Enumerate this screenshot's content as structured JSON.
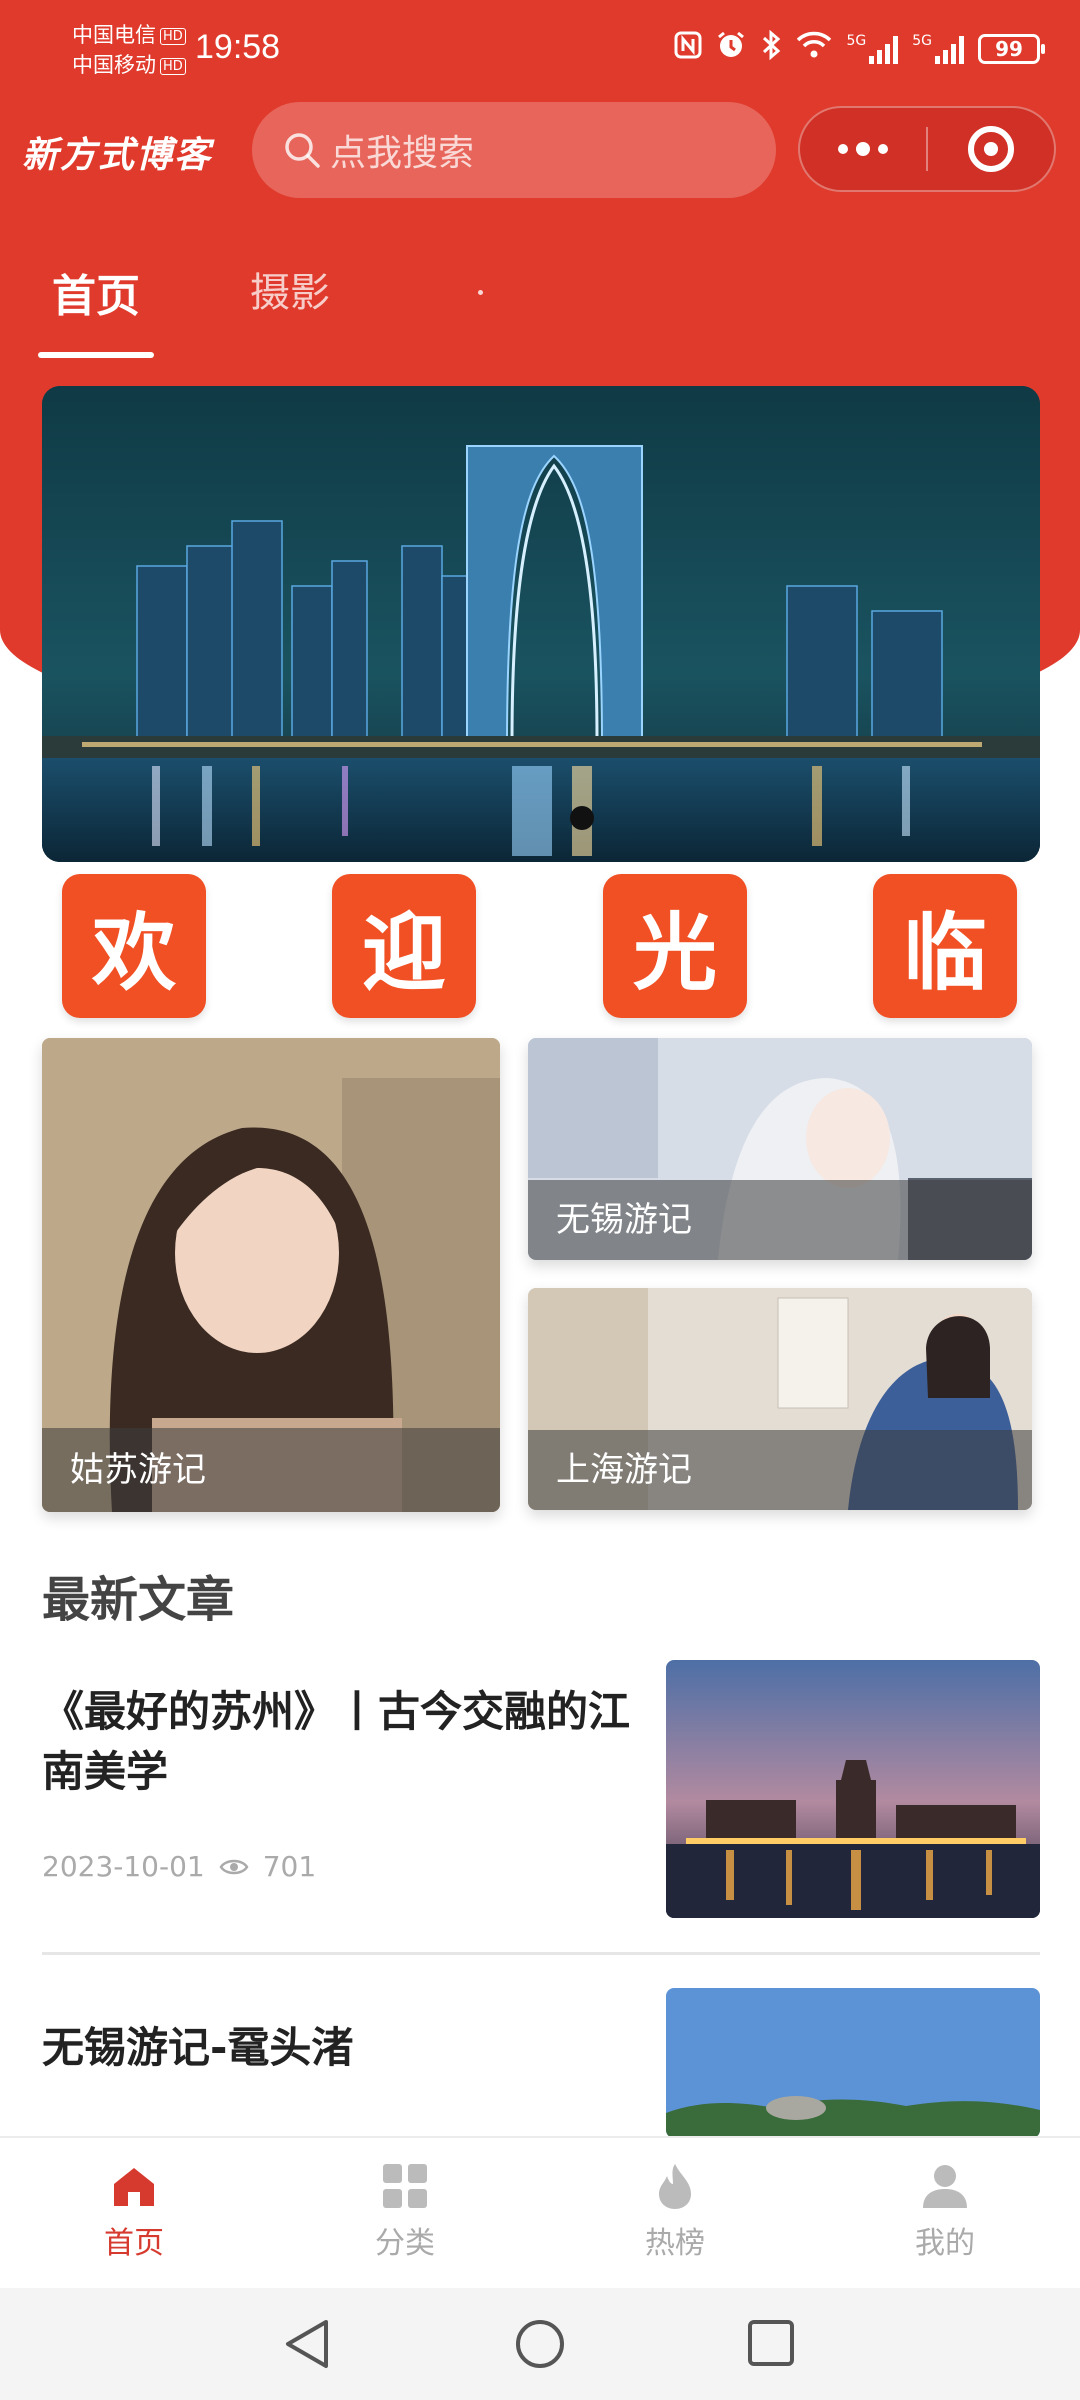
{
  "status_bar": {
    "carrier_1": "中国电信",
    "carrier_2": "中国移动",
    "hd": "HD",
    "time": "19:58",
    "net_1": "5G",
    "net_2": "5G",
    "battery": "99"
  },
  "header": {
    "logo": "新方式博客",
    "search_placeholder": "点我搜索"
  },
  "tabs": [
    {
      "label": "首页",
      "active": true
    },
    {
      "label": "摄影",
      "active": false
    }
  ],
  "welcome": [
    "欢",
    "迎",
    "光",
    "临"
  ],
  "grid_cards": [
    {
      "caption": "姑苏游记"
    },
    {
      "caption": "无锡游记"
    },
    {
      "caption": "上海游记"
    }
  ],
  "section": {
    "title": "最新文章"
  },
  "articles": [
    {
      "title": "《最好的苏州》丨古今交融的江南美学",
      "date": "2023-10-01",
      "views": "701"
    },
    {
      "title": "无锡游记-鼋头渚"
    }
  ],
  "tabbar": [
    {
      "label": "首页",
      "icon": "home-icon",
      "active": true
    },
    {
      "label": "分类",
      "icon": "grid-icon",
      "active": false
    },
    {
      "label": "热榜",
      "icon": "flame-icon",
      "active": false
    },
    {
      "label": "我的",
      "icon": "user-icon",
      "active": false
    }
  ],
  "colors": {
    "brand_red": "#e03a2c",
    "welcome_tile": "#f05024",
    "active_tab": "#d63a2e"
  }
}
